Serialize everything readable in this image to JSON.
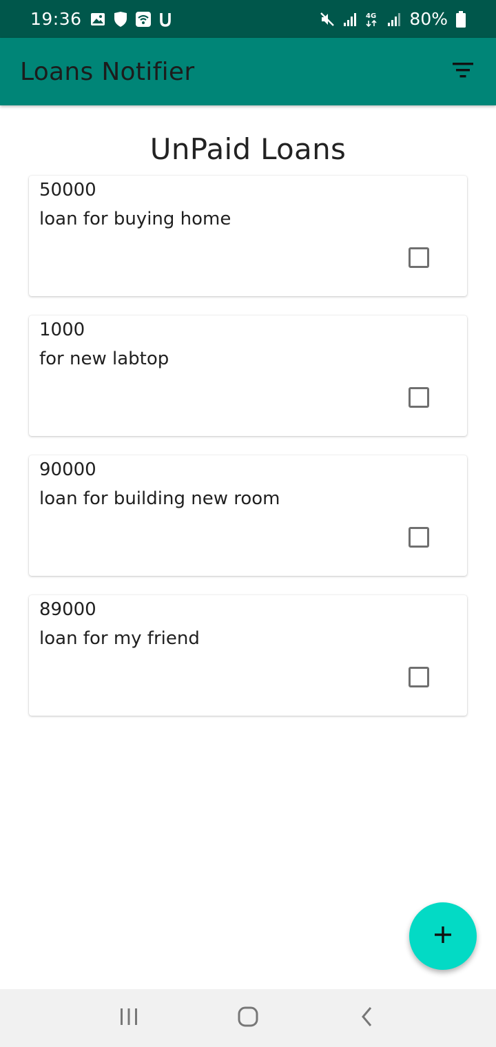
{
  "status_bar": {
    "time": "19:36",
    "battery_text": "80%",
    "icons_left": [
      "image-icon",
      "shield-icon",
      "wifi-icon",
      "u-icon"
    ],
    "icons_right": [
      "mute-icon",
      "signal-icon",
      "4g-icon",
      "signal-icon",
      "battery-icon"
    ]
  },
  "app_bar": {
    "title": "Loans Notifier",
    "action_icon": "filter-icon"
  },
  "main": {
    "heading": "UnPaid Loans",
    "loans": [
      {
        "amount": "50000",
        "description": "loan for buying home",
        "paid": false
      },
      {
        "amount": "1000",
        "description": "for new labtop",
        "paid": false
      },
      {
        "amount": "90000",
        "description": "loan for building new room",
        "paid": false
      },
      {
        "amount": "89000",
        "description": "loan for my friend",
        "paid": false
      }
    ]
  },
  "fab": {
    "icon": "plus-icon"
  },
  "nav_bar": {
    "icons": [
      "recents-icon",
      "home-icon",
      "back-icon"
    ]
  },
  "colors": {
    "status_bar": "#00574b",
    "app_bar": "#008577",
    "fab": "#03dac5",
    "nav_bar": "#f1f1f1"
  }
}
